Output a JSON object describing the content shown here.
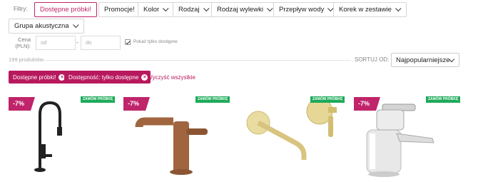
{
  "filters": {
    "label": "Filtry:",
    "chips": [
      {
        "label": "Dostępne próbki!",
        "active": true
      },
      {
        "label": "Promocje!",
        "active": false
      },
      {
        "label": "Kolor",
        "active": false
      },
      {
        "label": "Rodzaj",
        "active": false
      },
      {
        "label": "Rodzaj wylewki",
        "active": false
      },
      {
        "label": "Przepływ wody",
        "active": false
      },
      {
        "label": "Korek w zestawie",
        "active": false
      },
      {
        "label": "Grupa akustyczna",
        "active": false
      }
    ]
  },
  "price": {
    "label_line1": "Cena",
    "label_line2": "(PLN):",
    "from_placeholder": "od",
    "to_placeholder": "do",
    "dash": "-",
    "available_only_label": "Pokaż tylko dostępne"
  },
  "results": {
    "count_text": "199 produktów",
    "sort_label": "SORTUJ OD:",
    "sort_value": "Najpopularniejsze"
  },
  "active_filters": {
    "tags": [
      {
        "label": "Dostępne próbki!"
      },
      {
        "label": "Dostępność: tylko dostępne"
      }
    ],
    "remove_icon": "×",
    "clear_all": "Wyczyść wszystkie"
  },
  "products": [
    {
      "discount": "-7%",
      "order_badge": "ZAMÓW PRÓBKĘ",
      "image": "black-pull-down-faucet"
    },
    {
      "discount": "-7%",
      "order_badge": "ZAMÓW PRÓBKĘ",
      "image": "bronze-faucet"
    },
    {
      "discount": "",
      "order_badge": "ZAMÓW PRÓBKĘ",
      "image": "brass-wall-faucet"
    },
    {
      "discount": "-7%",
      "order_badge": "ZAMÓW PRÓBKĘ",
      "image": "chrome-faucet"
    }
  ],
  "colors": {
    "accent": "#c0246a",
    "order_badge": "#1dab5a"
  }
}
